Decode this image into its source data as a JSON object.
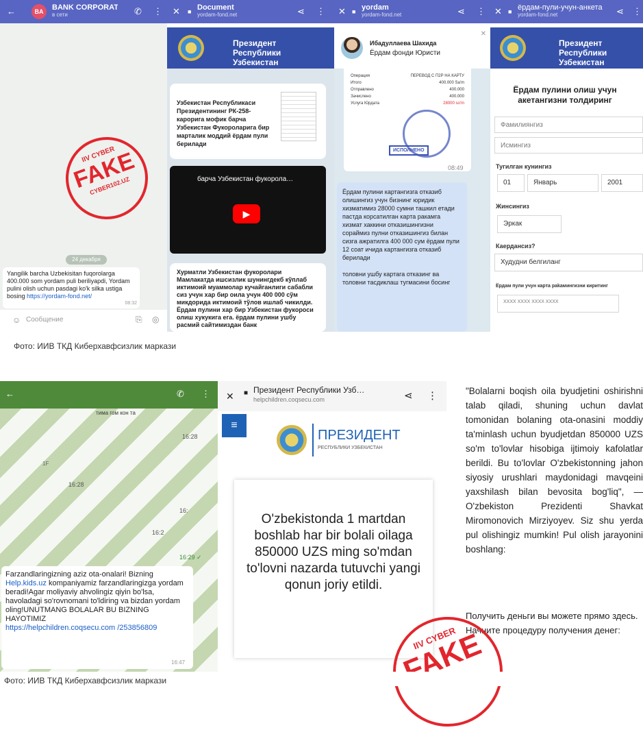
{
  "top": {
    "chat": {
      "back_icon": "back-arrow-icon",
      "avatar_initials": "BA",
      "name": "BANK CORPORATI",
      "status": "в сети",
      "date_badge": "24 декабря",
      "message": "Yangilik barcha Uzbekisitan fuqorolarga 400.000 som yordam puli beriliyapdi, Yordam pulini olish uchun pasdagi ko'k silka ustiga bosing ",
      "link": "https://yordam-fond.net/",
      "time": "08:32",
      "input_placeholder": "Сообщение"
    },
    "doc": {
      "title": "Document",
      "url": "yordam-fond.net",
      "hdr": "Президент Республики Узбекистан",
      "text": "Узбекистан Республикаси Президентининг РК-258-карорига мофик барча Узбекистан Фукороларига бир марталик моддий ёрдам пули берилади",
      "video_title": "барча Узбекистан фукорола…",
      "text2": "Хурматли Узбекистан фукоролари Мамлакатда ишсизлик шунингдекб кўплаб иктимоий муаммолар кучайганлиги сабабли сиз учун хар бир оила учун 400 000 сўм микдорида иктимоий тўлов ишлаб чикилди. Ёрдам пулини хар бир Узбекистан фукороси олиш хукукига ега. ёрдам пулини ушбу расмий сайтимиздан банк"
    },
    "yordam": {
      "title": "yordam",
      "url": "yordam-fond.net",
      "agent_name": "Ибадуллаева Шахида",
      "agent_role": "Ёрдам фонди Юристи",
      "receipt_rows": [
        [
          "Операция",
          "ПЕРЕВОД С П2Р НА КАРТУ"
        ],
        [
          "Итого",
          "400.000 Sa'm"
        ],
        [
          "Отправлено",
          "400.000"
        ],
        [
          "Зачислено",
          "400.000"
        ],
        [
          "Услуга Юрдата",
          "28000 so'm"
        ]
      ],
      "stamp_text": "ИСПОЛНЕНО",
      "time": "08:49",
      "message": "Ёрдам пулини картангизга отказиб олишингиз учун бизнинг юридик хизматимиз 28000 сумни ташкил етади пастда корсатилган карта ракамга хизмат хаккини отказишингизни сораймиз пулни отказишингиз билан сизга ажратилга 400 000 сум ёрдам пули 12 соат ичида картангизга отказиб берилади",
      "message2": "толовни ушбу картага отказинг ва толовни тасдиклаш тугмасини босинг"
    },
    "form": {
      "title": "ёрдам-пули-учун-анкета",
      "url": "yordam-fond.net",
      "hdr": "Президент Республики Узбекистан",
      "heading": "Ёрдам пулини олиш учун акетангизни толдиринг",
      "f1": "Фамилиянгиз",
      "f2": "Исмингиз",
      "dob_label": "Тугилган кунингиз",
      "day": "01",
      "month": "Январь",
      "year": "2001",
      "gender_label": "Жинсингиз",
      "gender": "Эркак",
      "region_label": "Каердансиз?",
      "region": "Худудни белгиланг",
      "card_label": "Ёрдам пули учун карта раkамингизни киритинг",
      "card_placeholder": "XXXX XXXX XXXX XXXX"
    },
    "watermark": {
      "l1": "IIV CYBER",
      "l2": "FAKE",
      "l3": "CYBER102.UZ"
    },
    "caption": "Фото: ИИВ ТКД Киберхавфсизлик маркази"
  },
  "bottom": {
    "chat": {
      "times": [
        "16:28",
        "16:28",
        "16:",
        "16:2",
        "16:29 ✓",
        "16:47"
      ],
      "misc_text": "тима гом кон та",
      "msg_a": "Farzandlaringizning aziz ota-onalari! Bizning ",
      "msg_link1": "Help.kids.uz",
      "msg_b": " kompaniyamiz farzandlaringizga yordam beradi!Agar moliyaviy ahvolingiz qiyin bo'lsa, havoladagi so'rovnomani to'ldiring va bizdan yordam oling!UNUTMANG BOLALAR BU BIZNING HAYOTIMIZ",
      "msg_link2": "https://helpchildren.coqsecu.com /253856809",
      "small_label": "1F"
    },
    "browser": {
      "title": "Президент Республики Узб…",
      "url": "helpchildren.coqsecu.com",
      "logo_big": "ПРЕЗИДЕНТ",
      "logo_small": "РЕСПУБЛИКИ УЗБЕКИСТАН",
      "text": "O'zbekistonda 1 martdan boshlab har bir bolali oilaga 850000 UZS ming so'mdan to'lovni nazarda tutuvchi yangi qonun joriy etildi."
    },
    "article": {
      "text": "\"Bolalarni boqish oila byudjetini oshirishni talab qiladi, shuning uchun davlat tomonidan bolaning ota-onasini moddiy ta'minlash uchun byudjetdan 850000 UZS so'm to'lovlar hisobiga ijtimoiy kafolatlar berildi. Bu to'lovlar O'zbekistonning jahon siyosiy urushlari maydonidagi mavqeini yaxshilash bilan bevosita bog'liq\", — O'zbekiston Prezidenti Shavkat Miromonovich Mirziyoyev. Siz shu yerda pul olishingiz mumkin! Pul olish jarayonini boshlang:",
      "ru": "Получить деньги вы можете прямо здесь. Начните процедуру получения денег:"
    },
    "watermark": {
      "l1": "IIV CYBER",
      "l2": "FAKE"
    },
    "caption": "Фото: ИИВ ТКД Киберхавфсизлик маркази"
  },
  "colors": {
    "bar": "#5865c2",
    "fake_red": "#e2262d",
    "gov_blue": "#3550a8",
    "tg_green": "#4f8a3a"
  }
}
